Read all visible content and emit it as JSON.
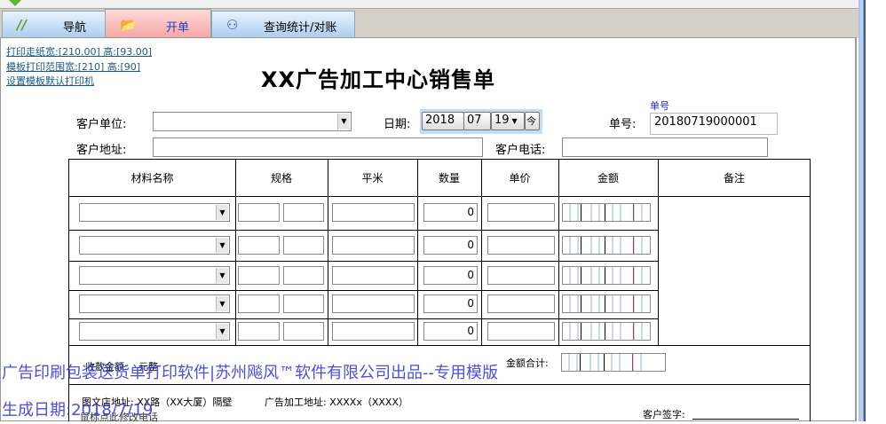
{
  "tabs": [
    {
      "label": "导航",
      "icon": "nav-slashes-icon"
    },
    {
      "label": "开单",
      "icon": "open-folder-icon",
      "active": true
    },
    {
      "label": "查询统计/对账",
      "icon": "binoculars-icon"
    }
  ],
  "links": {
    "paper_size": "打印走纸宽:[210.00] 高:[93.00]",
    "print_range": "模板打印范围宽:[210] 高:[90]",
    "set_printer": "设置模板默认打印机"
  },
  "form": {
    "title": "XX广告加工中心销售单",
    "customer_label": "客户单位:",
    "customer_value": "",
    "date_label": "日期:",
    "date_year": "2018",
    "date_month": "07",
    "date_day": "19",
    "today_button": "今",
    "order_no_caption": "单号",
    "order_no_label": "单号:",
    "order_no_value": "20180719000001",
    "address_label": "客户地址:",
    "address_value": "",
    "phone_label": "客户电话:",
    "phone_value": ""
  },
  "table": {
    "headers": [
      "材料名称",
      "规格",
      "平米",
      "数量",
      "单价",
      "金额",
      "备注"
    ],
    "rows": [
      {
        "quantity": "0"
      },
      {
        "quantity": "0"
      },
      {
        "quantity": "0"
      },
      {
        "quantity": "0"
      },
      {
        "quantity": "0"
      }
    ]
  },
  "footer": {
    "received_label": "收款金额:",
    "received_suffix": "元整",
    "total_label": "金额合计:",
    "shop_address": "图文店地址: XX路（XX大厦）隔壁",
    "ad_address": "广告加工地址: XXXXx（XXXX）",
    "edit_phone": "鼠标点此修改电话",
    "signature_label": "客户签字:"
  },
  "watermark": {
    "line1": "广告印刷包装送货单打印软件|苏州飚风™软件有限公司出品--专用模版",
    "line2": "生成日期:2018/7/19"
  },
  "colors": {
    "active_tab": "#f7a5a5",
    "tab": "#a9cdf0",
    "watermark": "#3a3ad8",
    "link": "#1a5a8a"
  }
}
